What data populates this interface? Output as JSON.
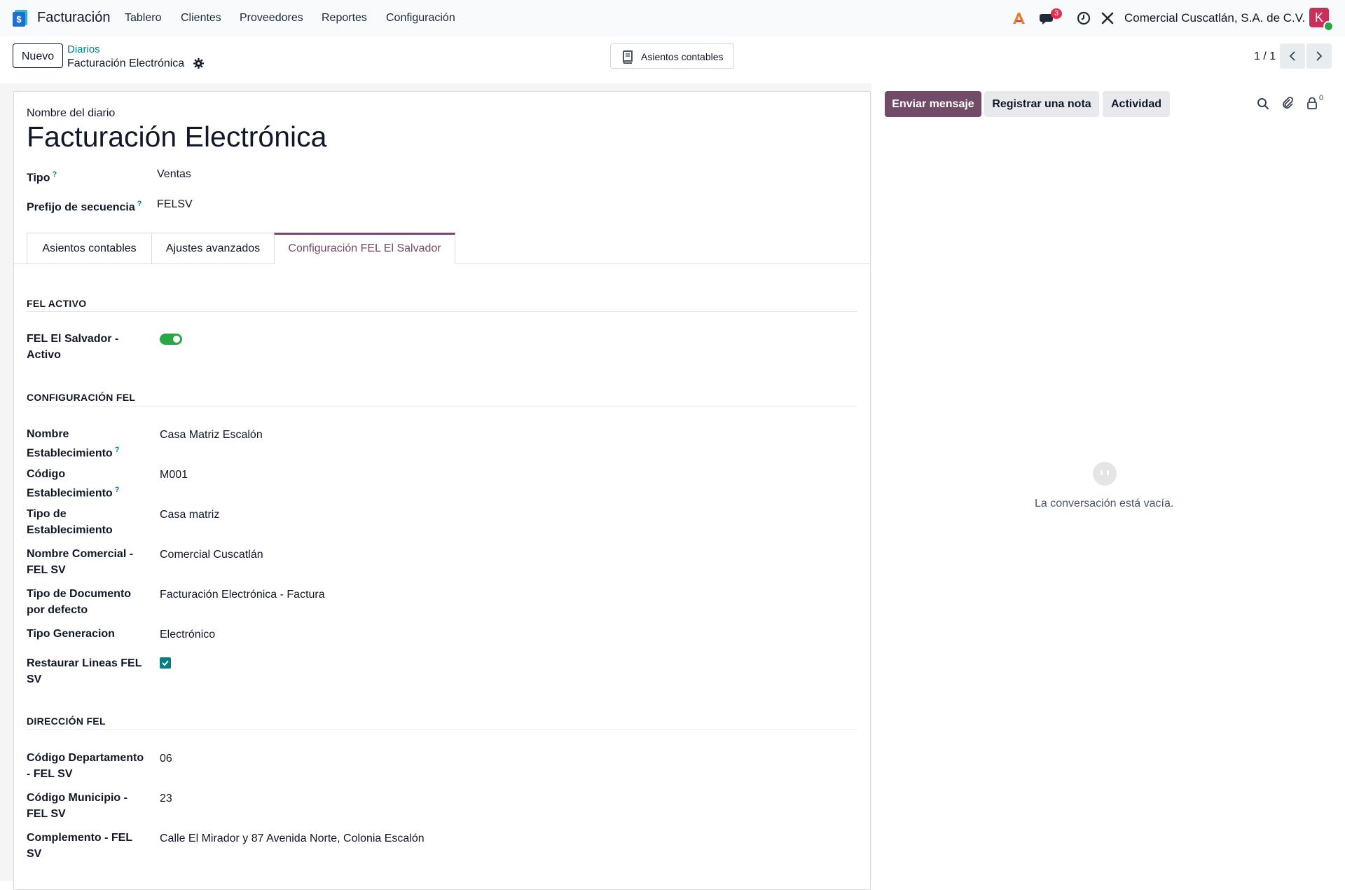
{
  "navbar": {
    "app_name": "Facturación",
    "menu": [
      "Tablero",
      "Clientes",
      "Proveedores",
      "Reportes",
      "Configuración"
    ],
    "messages_badge": "3",
    "company": "Comercial Cuscatlán, S.A. de C.V.",
    "avatar_letter": "K"
  },
  "control": {
    "new_label": "Nuevo",
    "breadcrumb_parent": "Diarios",
    "breadcrumb_current": "Facturación Electrónica",
    "smart_button": "Asientos contables",
    "pager": "1 / 1"
  },
  "form": {
    "name_label": "Nombre del diario",
    "name_value": "Facturación Electrónica",
    "tipo_label": "Tipo",
    "tipo_value": "Ventas",
    "prefijo_label": "Prefijo de secuencia",
    "prefijo_value": "FELSV",
    "help_mark": "?",
    "tabs": [
      "Asientos contables",
      "Ajustes avanzados",
      "Configuración FEL El Salvador"
    ],
    "sections": {
      "fel_activo": "FEL ACTIVO",
      "config_fel": "CONFIGURACIÓN FEL",
      "direccion_fel": "DIRECCIÓN FEL"
    },
    "fel_activo": {
      "label_1": "FEL El Salvador -",
      "label_2": "Activo",
      "enabled": true
    },
    "fields": {
      "nombre_est": {
        "l1": "Nombre",
        "l2": "Establecimiento",
        "value": "Casa Matriz Escalón"
      },
      "codigo_est": {
        "l1": "Código",
        "l2": "Establecimiento",
        "value": "M001"
      },
      "tipo_est": {
        "l1": "Tipo de",
        "l2": "Establecimiento",
        "value": "Casa matriz"
      },
      "nombre_com": {
        "l1": "Nombre Comercial -",
        "l2": "FEL SV",
        "value": "Comercial Cuscatlán"
      },
      "tipo_doc": {
        "l1": "Tipo de Documento",
        "l2": "por defecto",
        "value": "Facturación Electrónica - Factura"
      },
      "tipo_gen": {
        "l1": "Tipo Generacion",
        "value": "Electrónico"
      },
      "restaurar": {
        "l1": "Restaurar Lineas FEL",
        "l2": "SV",
        "checked": true
      },
      "cod_depto": {
        "l1": "Código Departamento",
        "l2": "- FEL SV",
        "value": "06"
      },
      "cod_muni": {
        "l1": "Código Municipio -",
        "l2": "FEL SV",
        "value": "23"
      },
      "complemento": {
        "l1": "Complemento - FEL",
        "l2": "SV",
        "value": "Calle El Mirador y 87 Avenida Norte, Colonia Escalón"
      }
    }
  },
  "chatter": {
    "send_message": "Enviar mensaje",
    "log_note": "Registrar una nota",
    "activity": "Actividad",
    "followers_count": "0",
    "empty_text": "La conversación está vacía."
  },
  "colors": {
    "brand": "#714b67",
    "link": "#017e84",
    "toggle_on": "#28a745",
    "badge": "#e0314f"
  }
}
